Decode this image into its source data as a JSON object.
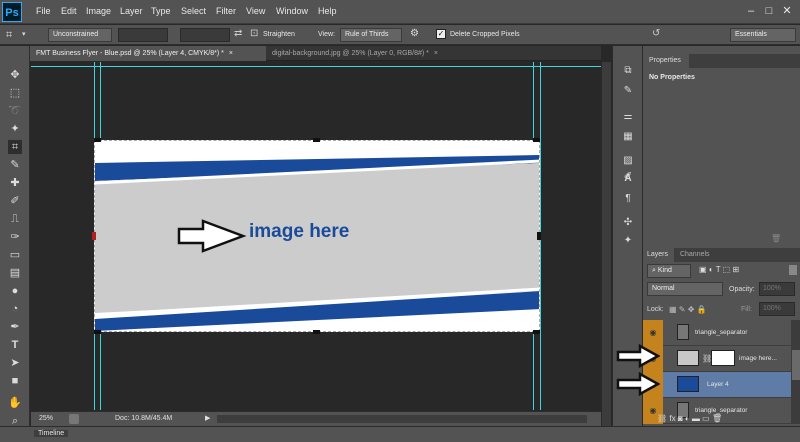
{
  "app": {
    "logo": "Ps"
  },
  "menu": [
    "File",
    "Edit",
    "Image",
    "Layer",
    "Type",
    "Select",
    "Filter",
    "View",
    "Window",
    "Help"
  ],
  "window_controls": {
    "minimize": "–",
    "restore": "□",
    "close": "✕"
  },
  "options": {
    "ratio": "Unconstrained",
    "straighten": "Straighten",
    "view_label": "View:",
    "view_value": "Rule of Thirds",
    "delete_cropped": "Delete Cropped Pixels",
    "workspace": "Essentials"
  },
  "tabs": [
    {
      "label": "FMT Business Flyer - Blue.psd @ 25% (Layer 4, CMYK/8*) *",
      "close": "×",
      "active": true
    },
    {
      "label": "digital-background.jpg @ 25% (Layer 0, RGB/8#) *",
      "close": "×",
      "active": false
    }
  ],
  "canvas": {
    "headline": "image here",
    "colors": {
      "blue": "#1a4a9a",
      "grey": "#cccccc",
      "white": "#ffffff",
      "guide": "#3fd5de"
    }
  },
  "status": {
    "zoom": "25%",
    "doc": "Doc: 10.8M/45.4M",
    "arrow": "▶"
  },
  "timeline": {
    "label": "Timeline"
  },
  "properties": {
    "tab": "Properties",
    "message": "No Properties"
  },
  "layers_panel": {
    "tabs": [
      "Layers",
      "Channels"
    ],
    "kind": "Kind",
    "blend_mode": "Normal",
    "opacity_label": "Opacity:",
    "opacity_value": "100%",
    "lock_label": "Lock:",
    "fill_label": "Fill:",
    "fill_value": "100%",
    "layers": [
      {
        "name": "triangle_separator",
        "selected": false
      },
      {
        "name": "image here...",
        "selected": false
      },
      {
        "name": "Layer 4",
        "selected": true
      },
      {
        "name": "triangle_separator",
        "selected": false
      }
    ],
    "footer_icons": [
      "link-icon",
      "fx-icon",
      "mask-icon",
      "adjustment-icon",
      "group-icon",
      "new-layer-icon",
      "trash-icon"
    ]
  },
  "icons": {
    "tools": [
      "move-icon",
      "marquee-icon",
      "lasso-icon",
      "magic-wand-icon",
      "crop-icon",
      "eyedropper-icon",
      "healing-icon",
      "brush-icon",
      "clone-stamp-icon",
      "history-brush-icon",
      "eraser-icon",
      "gradient-icon",
      "blur-icon",
      "dodge-icon",
      "pen-icon",
      "type-icon",
      "path-select-icon",
      "shape-icon",
      "hand-icon",
      "zoom-icon"
    ]
  }
}
